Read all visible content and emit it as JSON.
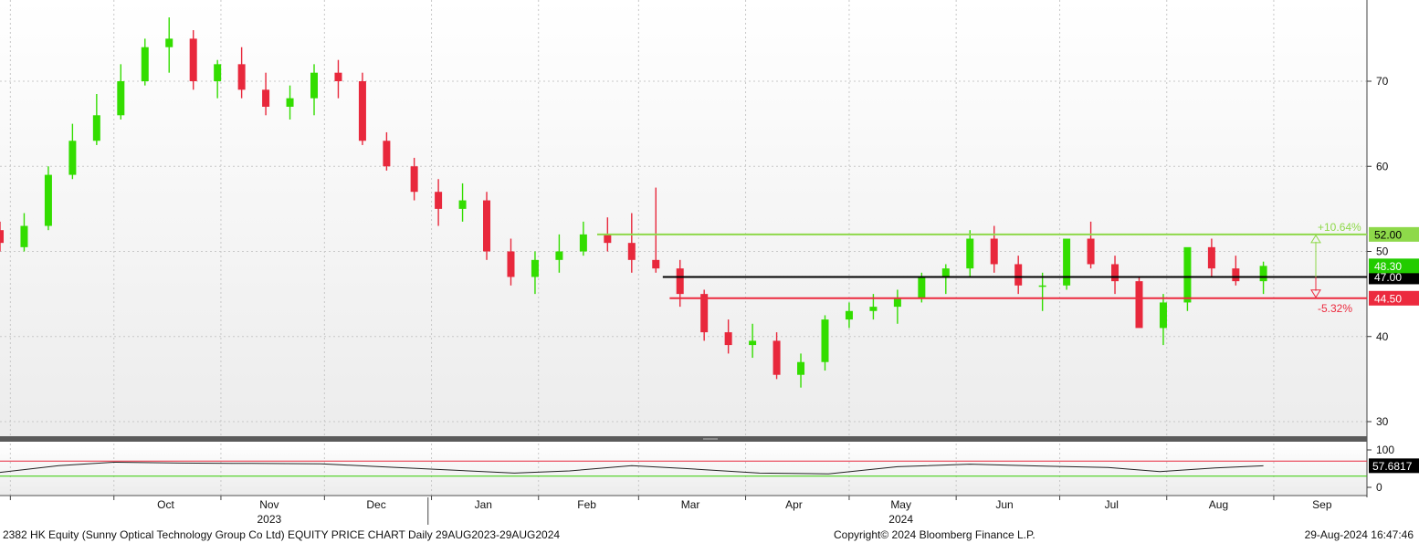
{
  "colors": {
    "up": "#33dd00",
    "down": "#e8283c",
    "resistance": "#8ed94a",
    "mid_level": "#000000",
    "support": "#ec2a3e",
    "last_price": "#22cc00",
    "rsi_line": "#222222",
    "rsi_upper": "#e8283c",
    "rsi_lower": "#33cc00"
  },
  "chart_data": [
    {
      "type": "candlestick",
      "title": "2382 HK Equity (Sunny Optical Technology Group Co Ltd) EQUITY PRICE CHART",
      "frequency": "Daily",
      "date_range": "29AUG2023-29AUG2024",
      "ylim": [
        28,
        79
      ],
      "y_ticks": [
        30,
        40,
        50,
        60,
        70
      ],
      "grid": true,
      "x_ticks": [
        "Oct",
        "Nov",
        "Dec",
        "Jan",
        "Feb",
        "Mar",
        "Apr",
        "May",
        "Jun",
        "Jul",
        "Aug",
        "Sep"
      ],
      "year_labels": [
        "2023",
        "2024"
      ],
      "series": [
        {
          "x": [
            "2023-08-29",
            "2023-09-05",
            "2023-09-12",
            "2023-09-19",
            "2023-09-26",
            "2023-10-03",
            "2023-10-10",
            "2023-10-17",
            "2023-10-24",
            "2023-10-31",
            "2023-11-07",
            "2023-11-14",
            "2023-11-21",
            "2023-11-28",
            "2023-12-05",
            "2023-12-12",
            "2023-12-19",
            "2023-12-27",
            "2024-01-03",
            "2024-01-10",
            "2024-01-17",
            "2024-01-24",
            "2024-01-31",
            "2024-02-07",
            "2024-02-14",
            "2024-02-21",
            "2024-02-28",
            "2024-03-06",
            "2024-03-13",
            "2024-03-20",
            "2024-03-27",
            "2024-04-03",
            "2024-04-10",
            "2024-04-17",
            "2024-04-24",
            "2024-05-01",
            "2024-05-08",
            "2024-05-15",
            "2024-05-22",
            "2024-05-29",
            "2024-06-05",
            "2024-06-12",
            "2024-06-19",
            "2024-06-26",
            "2024-07-03",
            "2024-07-10",
            "2024-07-17",
            "2024-07-24",
            "2024-07-31",
            "2024-08-07",
            "2024-08-14",
            "2024-08-21",
            "2024-08-29"
          ],
          "open": [
            52.5,
            50.5,
            53.0,
            59.0,
            63.0,
            66.0,
            70.0,
            74.0,
            75.0,
            70.0,
            72.0,
            69.0,
            67.0,
            68.0,
            71.0,
            70.0,
            63.0,
            60.0,
            57.0,
            55.0,
            56.0,
            50.0,
            47.0,
            49.0,
            50.0,
            52.0,
            51.0,
            49.0,
            48.0,
            45.0,
            40.5,
            39.0,
            39.5,
            35.5,
            37.0,
            42.0,
            43.0,
            43.5,
            44.5,
            47.0,
            48.0,
            51.5,
            48.5,
            46.0,
            46.0,
            51.5,
            48.5,
            46.5,
            41.0,
            44.0,
            50.5,
            48.0,
            46.5
          ],
          "high": [
            53.5,
            54.5,
            60.0,
            65.0,
            68.5,
            72.0,
            75.0,
            77.5,
            76.0,
            72.5,
            74.0,
            71.0,
            69.5,
            72.0,
            72.5,
            71.0,
            64.0,
            61.0,
            58.5,
            58.0,
            57.0,
            51.5,
            50.0,
            52.0,
            53.5,
            54.0,
            54.5,
            57.5,
            49.0,
            45.5,
            42.0,
            41.5,
            40.5,
            38.0,
            42.5,
            44.0,
            45.0,
            45.5,
            47.5,
            48.5,
            52.5,
            53.0,
            49.5,
            47.5,
            51.5,
            53.5,
            49.5,
            47.0,
            45.0,
            49.0,
            51.5,
            49.5,
            48.8
          ],
          "low": [
            50.0,
            50.0,
            52.5,
            58.5,
            62.5,
            65.5,
            69.5,
            71.0,
            69.0,
            68.0,
            68.0,
            66.0,
            65.5,
            66.0,
            68.0,
            62.5,
            59.5,
            56.0,
            53.0,
            53.5,
            49.0,
            46.0,
            45.0,
            47.5,
            49.5,
            50.0,
            47.5,
            47.5,
            43.5,
            39.5,
            38.0,
            37.5,
            35.0,
            34.0,
            36.0,
            41.0,
            42.0,
            41.5,
            44.0,
            45.0,
            47.0,
            47.5,
            45.0,
            43.0,
            45.5,
            48.0,
            45.0,
            42.0,
            39.0,
            43.0,
            47.0,
            46.0,
            45.0
          ],
          "close": [
            51.0,
            53.0,
            59.0,
            63.0,
            66.0,
            70.0,
            74.0,
            75.0,
            70.0,
            72.0,
            69.0,
            67.0,
            68.0,
            71.0,
            70.0,
            63.0,
            60.0,
            57.0,
            55.0,
            56.0,
            50.0,
            47.0,
            49.0,
            50.0,
            52.0,
            51.0,
            49.0,
            48.0,
            45.0,
            40.5,
            39.0,
            39.5,
            35.5,
            37.0,
            42.0,
            43.0,
            43.5,
            44.5,
            47.0,
            48.0,
            51.5,
            48.5,
            46.0,
            46.0,
            51.5,
            48.5,
            46.5,
            41.0,
            44.0,
            50.5,
            48.0,
            46.5,
            48.3
          ]
        }
      ],
      "levels": [
        {
          "value": 52.0,
          "label": "52.00",
          "pct_label": "+10.64%",
          "role": "resistance"
        },
        {
          "value": 47.0,
          "label": "47.00",
          "role": "reference"
        },
        {
          "value": 44.5,
          "label": "44.50",
          "pct_label": "-5.32%",
          "role": "support"
        }
      ],
      "last_price": {
        "value": 48.3,
        "label": "48.30"
      }
    },
    {
      "type": "line",
      "name": "RSI",
      "ylim": [
        0,
        100
      ],
      "y_ticks": [
        0,
        100
      ],
      "upper_band": 70,
      "lower_band": 30,
      "last_value": {
        "value": 57.6817,
        "label": "57.6817"
      },
      "series": [
        {
          "x": [
            "2023-08-29",
            "2023-09-15",
            "2023-10-01",
            "2023-10-20",
            "2023-11-10",
            "2023-11-30",
            "2023-12-15",
            "2024-01-05",
            "2024-01-25",
            "2024-02-10",
            "2024-02-28",
            "2024-03-15",
            "2024-04-05",
            "2024-04-25",
            "2024-05-15",
            "2024-06-05",
            "2024-06-25",
            "2024-07-15",
            "2024-07-30",
            "2024-08-15",
            "2024-08-29"
          ],
          "values": [
            40,
            58,
            67,
            65,
            64,
            63,
            56,
            47,
            38,
            44,
            58,
            50,
            38,
            36,
            55,
            62,
            57,
            53,
            42,
            52,
            57.6817
          ]
        }
      ]
    }
  ],
  "footer": {
    "title_text": "2382 HK Equity (Sunny Optical Technology Group Co Ltd) EQUITY PRICE CHART  Daily 29AUG2023-29AUG2024",
    "copyright": "Copyright© 2024 Bloomberg Finance L.P.",
    "timestamp": "29-Aug-2024 16:47:46"
  }
}
